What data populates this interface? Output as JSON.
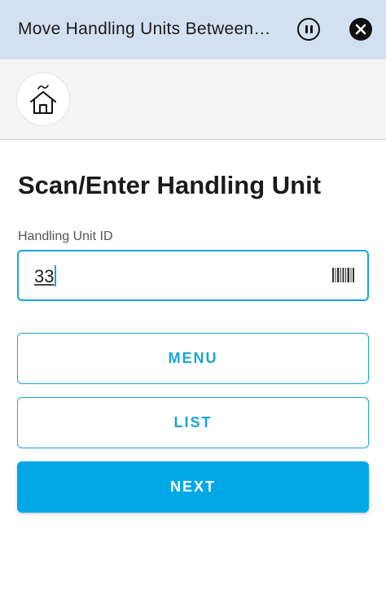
{
  "window": {
    "title": "Move Handling Units Between Storage Bins",
    "pause_icon": "pause-circle-icon",
    "close_icon": "close-circle-icon"
  },
  "nav": {
    "home_icon": "home-icon"
  },
  "main": {
    "heading": "Scan/Enter Handling Unit",
    "field_label": "Handling Unit ID",
    "field_value": "33",
    "barcode_icon": "barcode-icon"
  },
  "buttons": {
    "menu": "MENU",
    "list": "LIST",
    "next": "NEXT"
  },
  "colors": {
    "titlebar": "#d3e0f1",
    "accent": "#1aa4d8",
    "primary_button": "#02a8e6"
  }
}
